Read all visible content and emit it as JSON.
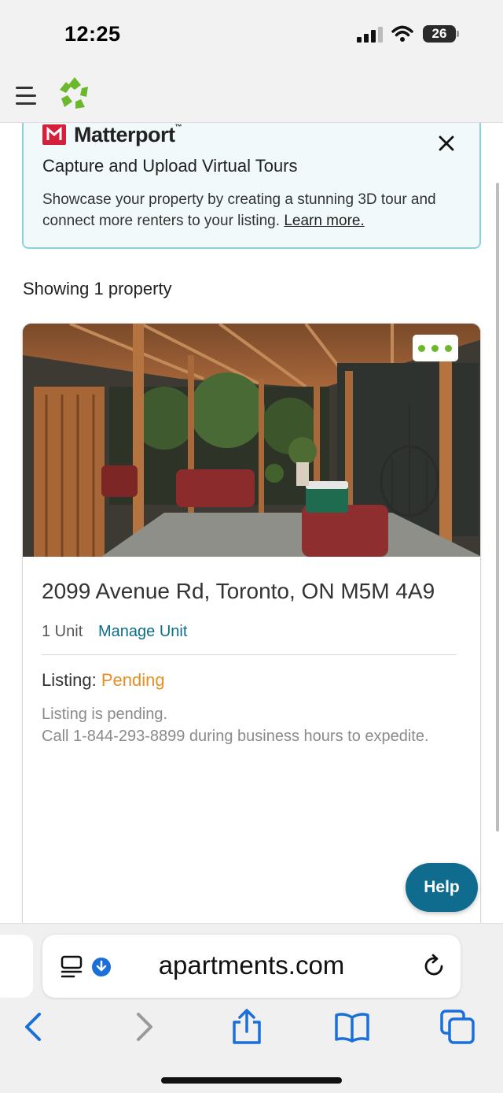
{
  "status_bar": {
    "time": "12:25",
    "battery": "26"
  },
  "promo": {
    "brand": "Matterport",
    "brand_tm": "™",
    "title": "Capture and Upload Virtual Tours",
    "body": "Showcase your property by creating a stunning 3D tour and connect more renters to your listing.",
    "link": "Learn more."
  },
  "results": {
    "showing": "Showing 1 property"
  },
  "property": {
    "address": "2099 Avenue Rd, Toronto, ON M5M 4A9",
    "units": "1 Unit",
    "manage_label": "Manage Unit",
    "listing_label": "Listing:",
    "listing_status": "Pending",
    "pending_line1": "Listing is pending.",
    "pending_line2": "Call 1-844-293-8899 during business hours to expedite."
  },
  "help": {
    "label": "Help"
  },
  "browser": {
    "url": "apartments.com"
  },
  "colors": {
    "brand_green": "#6cb82c",
    "manage_link": "#0b6e8c",
    "pending_orange": "#e88d22",
    "help_button": "#0f6c8e",
    "promo_border": "#8fd0dc",
    "safari_blue": "#1a6fd8"
  },
  "icons": [
    "hamburger-icon",
    "recycle-logo-icon",
    "matterport-logo-icon",
    "close-icon",
    "more-dots-icon",
    "reader-icon",
    "download-icon",
    "reload-icon",
    "back-icon",
    "forward-icon",
    "share-icon",
    "bookmarks-icon",
    "tabs-icon"
  ]
}
